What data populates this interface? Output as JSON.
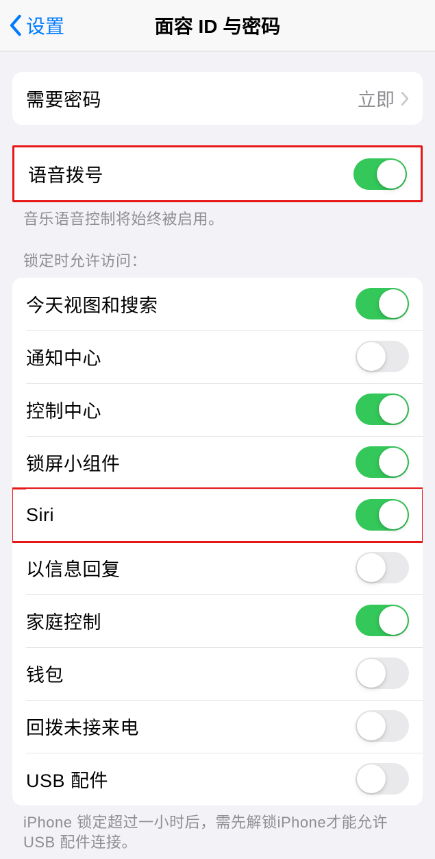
{
  "nav": {
    "back_label": "设置",
    "title": "面容 ID 与密码"
  },
  "require_passcode": {
    "label": "需要密码",
    "value": "立即"
  },
  "voice_dial": {
    "label": "语音拨号",
    "on": true,
    "footer": "音乐语音控制将始终被启用。"
  },
  "lock_access": {
    "header": "锁定时允许访问：",
    "items": [
      {
        "label": "今天视图和搜索",
        "on": true
      },
      {
        "label": "通知中心",
        "on": false
      },
      {
        "label": "控制中心",
        "on": true
      },
      {
        "label": "锁屏小组件",
        "on": true
      },
      {
        "label": "Siri",
        "on": true
      },
      {
        "label": "以信息回复",
        "on": false
      },
      {
        "label": "家庭控制",
        "on": true
      },
      {
        "label": "钱包",
        "on": false
      },
      {
        "label": "回拨未接来电",
        "on": false
      },
      {
        "label": "USB 配件",
        "on": false
      }
    ],
    "footer": "iPhone 锁定超过一小时后，需先解锁iPhone才能允许 USB 配件连接。"
  }
}
